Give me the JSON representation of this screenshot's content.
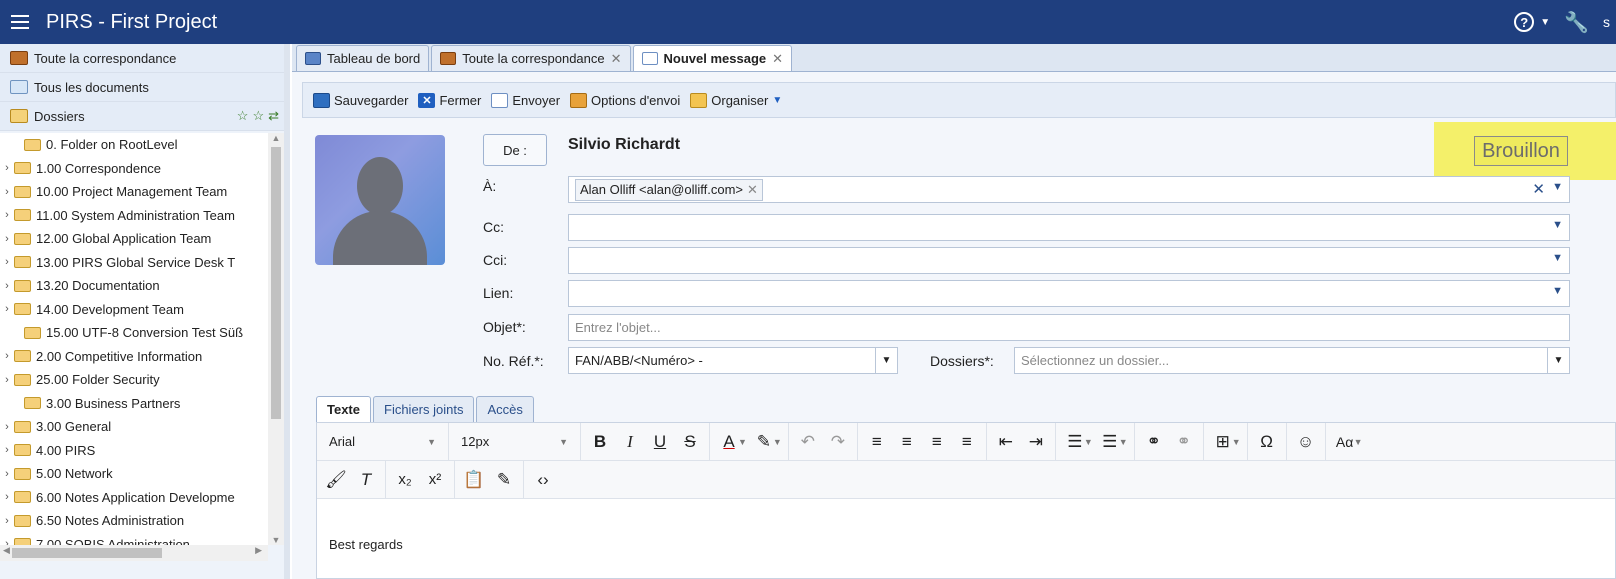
{
  "app": {
    "title": "PIRS  -  First Project",
    "user_initial": "s"
  },
  "sidebar": {
    "nav": [
      {
        "label": "Toute la correspondance",
        "icon": "correspondence-icon"
      },
      {
        "label": "Tous les documents",
        "icon": "documents-icon"
      },
      {
        "label": "Dossiers",
        "icon": "dossiers-icon"
      }
    ],
    "tree": [
      {
        "label": "0. Folder on RootLevel",
        "expandable": false
      },
      {
        "label": "1.00 Correspondence",
        "expandable": true
      },
      {
        "label": "10.00 Project Management Team",
        "expandable": true
      },
      {
        "label": "11.00 System Administration Team",
        "expandable": true
      },
      {
        "label": "12.00 Global Application Team",
        "expandable": true
      },
      {
        "label": "13.00 PIRS Global Service Desk T",
        "expandable": true
      },
      {
        "label": "13.20 Documentation",
        "expandable": true
      },
      {
        "label": "14.00 Development Team",
        "expandable": true
      },
      {
        "label": "15.00 UTF-8 Conversion Test Süß",
        "expandable": false
      },
      {
        "label": "2.00 Competitive Information",
        "expandable": true
      },
      {
        "label": "25.00 Folder Security",
        "expandable": true
      },
      {
        "label": "3.00 Business Partners",
        "expandable": false
      },
      {
        "label": "3.00 General",
        "expandable": true
      },
      {
        "label": "4.00 PIRS",
        "expandable": true
      },
      {
        "label": "5.00 Network",
        "expandable": true
      },
      {
        "label": "6.00 Notes Application Developme",
        "expandable": true
      },
      {
        "label": "6.50 Notes Administration",
        "expandable": true
      },
      {
        "label": "7.00 SOBIS Administration",
        "expandable": true
      }
    ]
  },
  "tabs": [
    {
      "label": "Tableau de bord",
      "closable": false
    },
    {
      "label": "Toute la correspondance",
      "closable": true
    },
    {
      "label": "Nouvel message",
      "closable": true,
      "active": true
    }
  ],
  "toolbar": {
    "save": "Sauvegarder",
    "close": "Fermer",
    "send": "Envoyer",
    "send_options": "Options d'envoi",
    "organize": "Organiser"
  },
  "form": {
    "from_label": "De :",
    "from_name": "Silvio Richardt",
    "status": "Brouillon",
    "to_label": "À:",
    "to_recipient": "Alan Olliff <alan@olliff.com>",
    "cc_label": "Cc:",
    "bcc_label": "Cci:",
    "link_label": "Lien:",
    "subject_label": "Objet*:",
    "subject_placeholder": "Entrez l'objet...",
    "ref_label": "No. Réf.*:",
    "ref_value": "FAN/ABB/<Numéro> -",
    "folders_label": "Dossiers*:",
    "folders_placeholder": "Sélectionnez un dossier..."
  },
  "editor": {
    "tabs": [
      "Texte",
      "Fichiers joints",
      "Accès"
    ],
    "font_family": "Arial",
    "font_size": "12px",
    "body": "Best regards"
  },
  "colors": {
    "topbar": "#1f3f7f",
    "draft_highlight": "#f4f06a"
  }
}
